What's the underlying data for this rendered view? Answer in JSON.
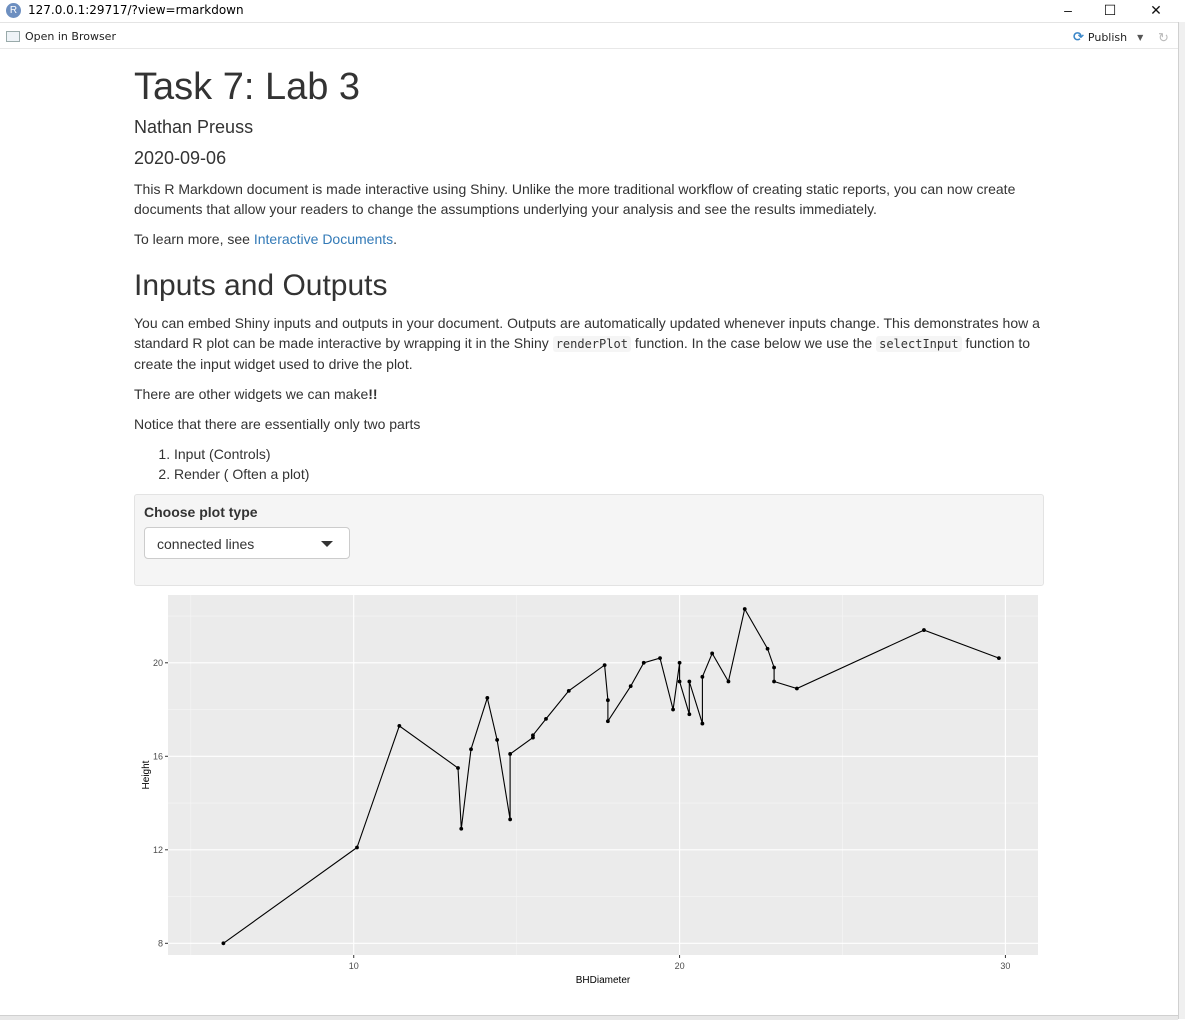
{
  "window": {
    "url": "127.0.0.1:29717/?view=rmarkdown",
    "app_icon": "R",
    "minimize": "–",
    "maximize": "☐",
    "close": "✕"
  },
  "toolbar": {
    "open_in_browser": "Open in Browser",
    "publish": "Publish"
  },
  "doc": {
    "title": "Task 7: Lab 3",
    "author": "Nathan Preuss",
    "date": "2020-09-06",
    "intro": "This R Markdown document is made interactive using Shiny. Unlike the more traditional workflow of creating static reports, you can now create documents that allow your readers to change the assumptions underlying your analysis and see the results immediately.",
    "learn_more_prefix": "To learn more, see ",
    "learn_more_link": "Interactive Documents",
    "learn_more_suffix": ".",
    "section_title": "Inputs and Outputs",
    "para1_a": "You can embed Shiny inputs and outputs in your document. Outputs are automatically updated whenever inputs change. This demonstrates how a standard R plot can be made interactive by wrapping it in the Shiny ",
    "para1_code1": "renderPlot",
    "para1_b": " function. In the case below we use the ",
    "para1_code2": "selectInput",
    "para1_c": " function to create the input widget used to drive the plot.",
    "para2_a": "There are other widgets we can make",
    "para2_bold": "!!",
    "para3": "Notice that there are essentially only two parts",
    "list": [
      "Input (Controls)",
      "Render ( Often a plot)"
    ],
    "select_label": "Choose plot type",
    "select_value": "connected lines"
  },
  "chart_data": {
    "type": "line",
    "xlabel": "BHDiameter",
    "ylabel": "Height",
    "xlim": [
      4.3,
      31.0
    ],
    "ylim": [
      7.5,
      22.9
    ],
    "x_ticks": [
      10,
      20,
      30
    ],
    "y_ticks": [
      8,
      12,
      16,
      20
    ],
    "grid": true,
    "background": "#ebebeb",
    "x": [
      6.0,
      10.1,
      11.4,
      13.2,
      13.3,
      13.6,
      14.1,
      14.4,
      14.8,
      14.8,
      15.5,
      15.5,
      15.9,
      16.6,
      17.7,
      17.8,
      17.8,
      18.5,
      18.9,
      19.4,
      19.8,
      20.0,
      20.0,
      20.3,
      20.3,
      20.7,
      20.7,
      21.0,
      21.5,
      22.0,
      22.7,
      22.9,
      22.9,
      23.6,
      27.5,
      29.8
    ],
    "y": [
      8.0,
      12.1,
      17.3,
      15.5,
      12.9,
      16.3,
      18.5,
      16.7,
      13.3,
      16.1,
      16.8,
      16.9,
      17.6,
      18.8,
      19.9,
      18.4,
      17.5,
      19.0,
      20.0,
      20.2,
      18.0,
      20.0,
      19.2,
      17.8,
      19.2,
      17.4,
      19.4,
      20.4,
      19.2,
      22.3,
      20.6,
      19.8,
      19.2,
      18.9,
      21.4,
      20.2
    ]
  }
}
